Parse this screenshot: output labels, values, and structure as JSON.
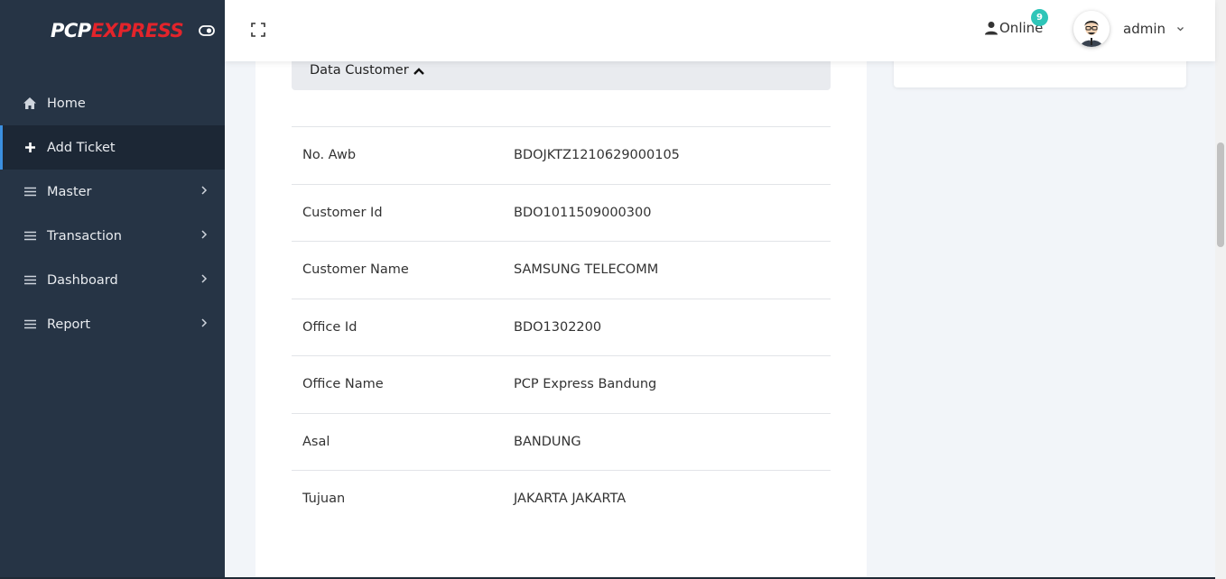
{
  "brand": {
    "logo_part1": "PCP",
    "logo_part2": "EXPRESS"
  },
  "sidebar": {
    "items": [
      {
        "label": "Home",
        "icon": "home-icon"
      },
      {
        "label": "Add Ticket",
        "icon": "plus-icon"
      },
      {
        "label": "Master",
        "icon": "menu-icon"
      },
      {
        "label": "Transaction",
        "icon": "menu-icon"
      },
      {
        "label": "Dashboard",
        "icon": "menu-icon"
      },
      {
        "label": "Report",
        "icon": "menu-icon"
      }
    ]
  },
  "topbar": {
    "online_label": "Online",
    "online_count": "9",
    "user_name": "admin"
  },
  "section": {
    "title": "Data Customer"
  },
  "customer": {
    "rows": [
      {
        "label": "No. Awb",
        "value": "BDOJKTZ1210629000105"
      },
      {
        "label": "Customer Id",
        "value": "BDO1011509000300"
      },
      {
        "label": "Customer Name",
        "value": "SAMSUNG TELECOMM"
      },
      {
        "label": "Office Id",
        "value": "BDO1302200"
      },
      {
        "label": "Office Name",
        "value": "PCP Express Bandung"
      },
      {
        "label": "Asal",
        "value": "BANDUNG"
      },
      {
        "label": "Tujuan",
        "value": "JAKARTA JAKARTA"
      }
    ]
  },
  "colors": {
    "sidebar_bg": "#263445",
    "sidebar_active_bg": "#1c2735",
    "active_accent": "#3b8fe0",
    "badge": "#2ec5b8",
    "brand_red": "#e3242b"
  }
}
